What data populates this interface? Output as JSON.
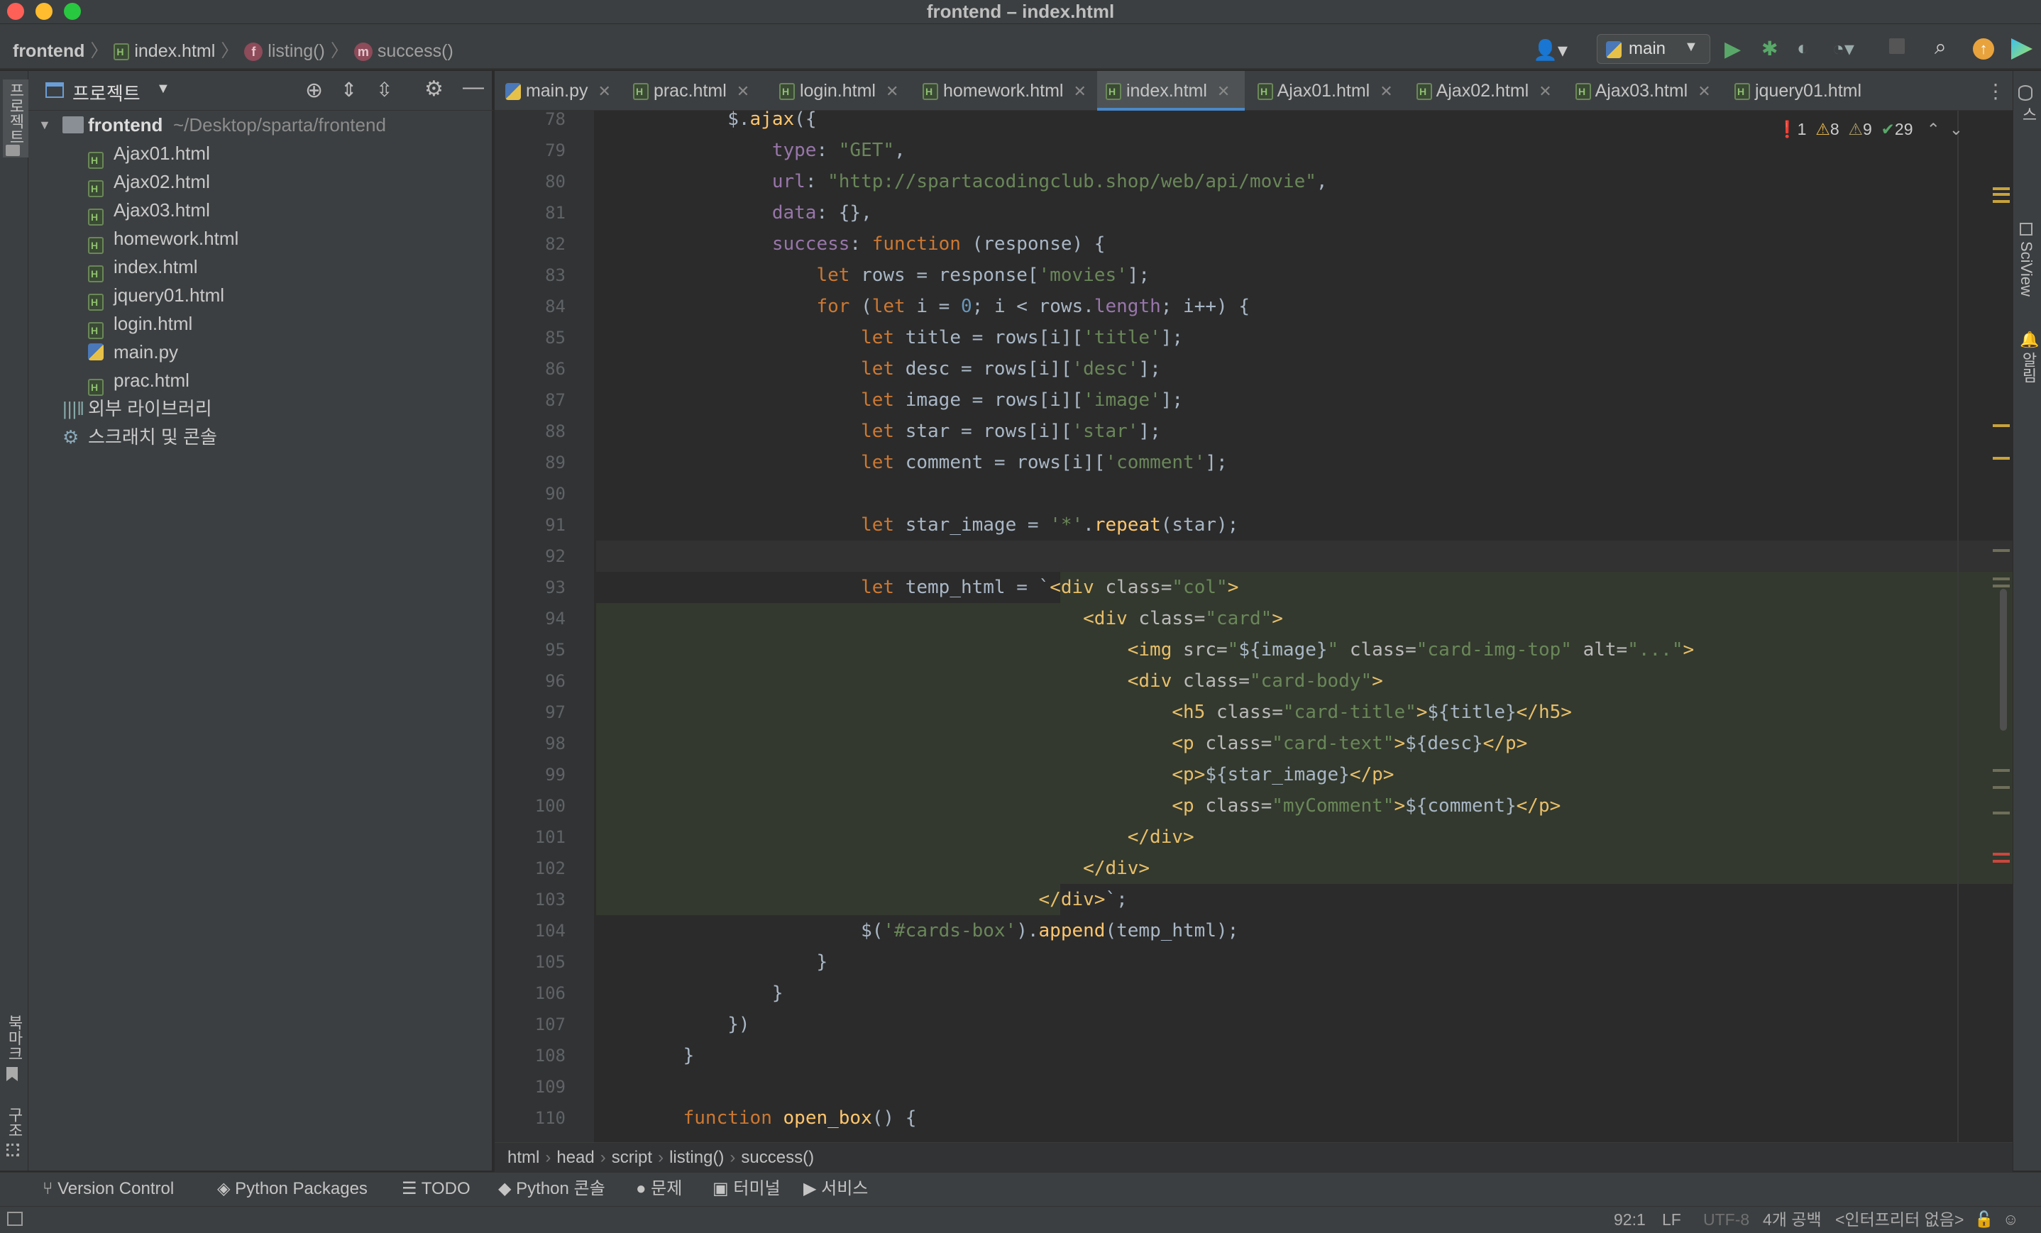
{
  "window": {
    "title": "frontend – index.html"
  },
  "navbar": {
    "project": "frontend",
    "file": "index.html",
    "func1_badge": "f",
    "func1": "listing()",
    "func2_badge": "m",
    "func2": "success()",
    "branch": "main"
  },
  "left_strip": {
    "project_label": "프로젝트",
    "bookmarks_label": "북마크",
    "structure_label": "구조"
  },
  "right_strip": {
    "db_label": "데이터베이스",
    "sciview_label": "SciView",
    "notif_label": "알림"
  },
  "project_panel": {
    "title": "프로젝트",
    "root": {
      "name": "frontend",
      "path": "~/Desktop/sparta/frontend"
    },
    "files": [
      "Ajax01.html",
      "Ajax02.html",
      "Ajax03.html",
      "homework.html",
      "index.html",
      "jquery01.html",
      "login.html",
      "main.py",
      "prac.html"
    ],
    "external_libs": "외부 라이브러리",
    "scratches": "스크래치 및 콘솔"
  },
  "tabs": [
    {
      "label": "main.py",
      "icon": "python-file-icon"
    },
    {
      "label": "prac.html",
      "icon": "html-file-icon"
    },
    {
      "label": "login.html",
      "icon": "html-file-icon"
    },
    {
      "label": "homework.html",
      "icon": "html-file-icon"
    },
    {
      "label": "index.html",
      "icon": "html-file-icon",
      "active": true
    },
    {
      "label": "Ajax01.html",
      "icon": "html-file-icon"
    },
    {
      "label": "Ajax02.html",
      "icon": "html-file-icon"
    },
    {
      "label": "Ajax03.html",
      "icon": "html-file-icon"
    },
    {
      "label": "jquery01.html",
      "icon": "html-file-icon"
    }
  ],
  "inspections": {
    "errors": "1",
    "warnings": "8",
    "weak_warnings": "9",
    "ok": "29"
  },
  "line_numbers": [
    "78",
    "79",
    "80",
    "81",
    "82",
    "83",
    "84",
    "85",
    "86",
    "87",
    "88",
    "89",
    "90",
    "91",
    "92",
    "93",
    "94",
    "95",
    "96",
    "97",
    "98",
    "99",
    "100",
    "101",
    "102",
    "103",
    "104",
    "105",
    "106",
    "107",
    "108",
    "109",
    "110"
  ],
  "breadcrumb": [
    "html",
    "head",
    "script",
    "listing()",
    "success()"
  ],
  "tool_windows": [
    "Version Control",
    "Python Packages",
    "TODO",
    "Python 콘솔",
    "문제",
    "터미널",
    "서비스"
  ],
  "status": {
    "position": "92:1",
    "line_sep": "LF",
    "encoding": "UTF-8",
    "indent": "4개 공백",
    "interpreter": "<인터프리터 없음>"
  },
  "colors": {
    "keyword": "#cc7832",
    "string": "#6a8759",
    "number": "#6897bb",
    "property": "#9876aa",
    "function": "#ffc66d",
    "tag": "#e8bf6a",
    "accent": "#4a88c7"
  }
}
